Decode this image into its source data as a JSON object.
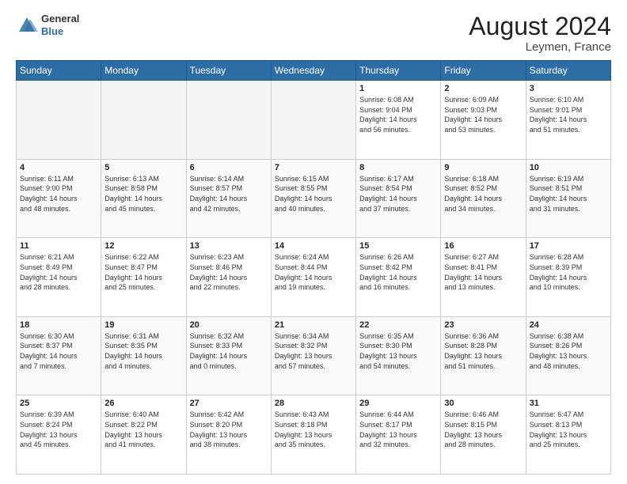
{
  "header": {
    "logo_general": "General",
    "logo_blue": "Blue",
    "month_year": "August 2024",
    "location": "Leymen, France"
  },
  "weekdays": [
    "Sunday",
    "Monday",
    "Tuesday",
    "Wednesday",
    "Thursday",
    "Friday",
    "Saturday"
  ],
  "weeks": [
    [
      {
        "day": "",
        "info": ""
      },
      {
        "day": "",
        "info": ""
      },
      {
        "day": "",
        "info": ""
      },
      {
        "day": "",
        "info": ""
      },
      {
        "day": "1",
        "info": "Sunrise: 6:08 AM\nSunset: 9:04 PM\nDaylight: 14 hours\nand 56 minutes."
      },
      {
        "day": "2",
        "info": "Sunrise: 6:09 AM\nSunset: 9:03 PM\nDaylight: 14 hours\nand 53 minutes."
      },
      {
        "day": "3",
        "info": "Sunrise: 6:10 AM\nSunset: 9:01 PM\nDaylight: 14 hours\nand 51 minutes."
      }
    ],
    [
      {
        "day": "4",
        "info": "Sunrise: 6:11 AM\nSunset: 9:00 PM\nDaylight: 14 hours\nand 48 minutes."
      },
      {
        "day": "5",
        "info": "Sunrise: 6:13 AM\nSunset: 8:58 PM\nDaylight: 14 hours\nand 45 minutes."
      },
      {
        "day": "6",
        "info": "Sunrise: 6:14 AM\nSunset: 8:57 PM\nDaylight: 14 hours\nand 42 minutes."
      },
      {
        "day": "7",
        "info": "Sunrise: 6:15 AM\nSunset: 8:55 PM\nDaylight: 14 hours\nand 40 minutes."
      },
      {
        "day": "8",
        "info": "Sunrise: 6:17 AM\nSunset: 8:54 PM\nDaylight: 14 hours\nand 37 minutes."
      },
      {
        "day": "9",
        "info": "Sunrise: 6:18 AM\nSunset: 8:52 PM\nDaylight: 14 hours\nand 34 minutes."
      },
      {
        "day": "10",
        "info": "Sunrise: 6:19 AM\nSunset: 8:51 PM\nDaylight: 14 hours\nand 31 minutes."
      }
    ],
    [
      {
        "day": "11",
        "info": "Sunrise: 6:21 AM\nSunset: 8:49 PM\nDaylight: 14 hours\nand 28 minutes."
      },
      {
        "day": "12",
        "info": "Sunrise: 6:22 AM\nSunset: 8:47 PM\nDaylight: 14 hours\nand 25 minutes."
      },
      {
        "day": "13",
        "info": "Sunrise: 6:23 AM\nSunset: 8:46 PM\nDaylight: 14 hours\nand 22 minutes."
      },
      {
        "day": "14",
        "info": "Sunrise: 6:24 AM\nSunset: 8:44 PM\nDaylight: 14 hours\nand 19 minutes."
      },
      {
        "day": "15",
        "info": "Sunrise: 6:26 AM\nSunset: 8:42 PM\nDaylight: 14 hours\nand 16 minutes."
      },
      {
        "day": "16",
        "info": "Sunrise: 6:27 AM\nSunset: 8:41 PM\nDaylight: 14 hours\nand 13 minutes."
      },
      {
        "day": "17",
        "info": "Sunrise: 6:28 AM\nSunset: 8:39 PM\nDaylight: 14 hours\nand 10 minutes."
      }
    ],
    [
      {
        "day": "18",
        "info": "Sunrise: 6:30 AM\nSunset: 8:37 PM\nDaylight: 14 hours\nand 7 minutes."
      },
      {
        "day": "19",
        "info": "Sunrise: 6:31 AM\nSunset: 8:35 PM\nDaylight: 14 hours\nand 4 minutes."
      },
      {
        "day": "20",
        "info": "Sunrise: 6:32 AM\nSunset: 8:33 PM\nDaylight: 14 hours\nand 0 minutes."
      },
      {
        "day": "21",
        "info": "Sunrise: 6:34 AM\nSunset: 8:32 PM\nDaylight: 13 hours\nand 57 minutes."
      },
      {
        "day": "22",
        "info": "Sunrise: 6:35 AM\nSunset: 8:30 PM\nDaylight: 13 hours\nand 54 minutes."
      },
      {
        "day": "23",
        "info": "Sunrise: 6:36 AM\nSunset: 8:28 PM\nDaylight: 13 hours\nand 51 minutes."
      },
      {
        "day": "24",
        "info": "Sunrise: 6:38 AM\nSunset: 8:26 PM\nDaylight: 13 hours\nand 48 minutes."
      }
    ],
    [
      {
        "day": "25",
        "info": "Sunrise: 6:39 AM\nSunset: 8:24 PM\nDaylight: 13 hours\nand 45 minutes."
      },
      {
        "day": "26",
        "info": "Sunrise: 6:40 AM\nSunset: 8:22 PM\nDaylight: 13 hours\nand 41 minutes."
      },
      {
        "day": "27",
        "info": "Sunrise: 6:42 AM\nSunset: 8:20 PM\nDaylight: 13 hours\nand 38 minutes."
      },
      {
        "day": "28",
        "info": "Sunrise: 6:43 AM\nSunset: 8:18 PM\nDaylight: 13 hours\nand 35 minutes."
      },
      {
        "day": "29",
        "info": "Sunrise: 6:44 AM\nSunset: 8:17 PM\nDaylight: 13 hours\nand 32 minutes."
      },
      {
        "day": "30",
        "info": "Sunrise: 6:46 AM\nSunset: 8:15 PM\nDaylight: 13 hours\nand 28 minutes."
      },
      {
        "day": "31",
        "info": "Sunrise: 6:47 AM\nSunset: 8:13 PM\nDaylight: 13 hours\nand 25 minutes."
      }
    ]
  ]
}
